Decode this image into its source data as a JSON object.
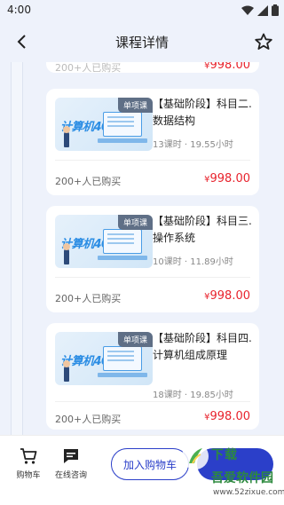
{
  "status": {
    "time": "4:00"
  },
  "header": {
    "title": "课程详情"
  },
  "partial_card": {
    "buyers": "200+人已购买",
    "price": "998.00"
  },
  "courses": [
    {
      "tag": "单项课",
      "thumb_logo": "计算机408",
      "title": "【基础阶段】科目二.数据结构",
      "meta": "13课时 · 19.55小时",
      "buyers": "200+人已购买",
      "currency": "¥",
      "price": "998.00"
    },
    {
      "tag": "单项课",
      "thumb_logo": "计算机408",
      "title": "【基础阶段】科目三.操作系统",
      "meta": "10课时 · 11.89小时",
      "buyers": "200+人已购买",
      "currency": "¥",
      "price": "998.00"
    },
    {
      "tag": "单项课",
      "thumb_logo": "计算机408",
      "title": "【基础阶段】科目四.计算机组成原理",
      "meta": "18课时 · 19.85小时",
      "buyers": "200+人已购买",
      "currency": "¥",
      "price": "998.00"
    }
  ],
  "bottom_bar": {
    "cart_label": "购物车",
    "consult_label": "在线咨询",
    "add_cart_label": "加入购物车"
  },
  "watermark": {
    "title": "下载",
    "text": "吾爱软件园",
    "url": "www.52zixue.com"
  },
  "colors": {
    "accent": "#2b3fc9",
    "price": "#e8232d",
    "background": "#eef2fb"
  }
}
